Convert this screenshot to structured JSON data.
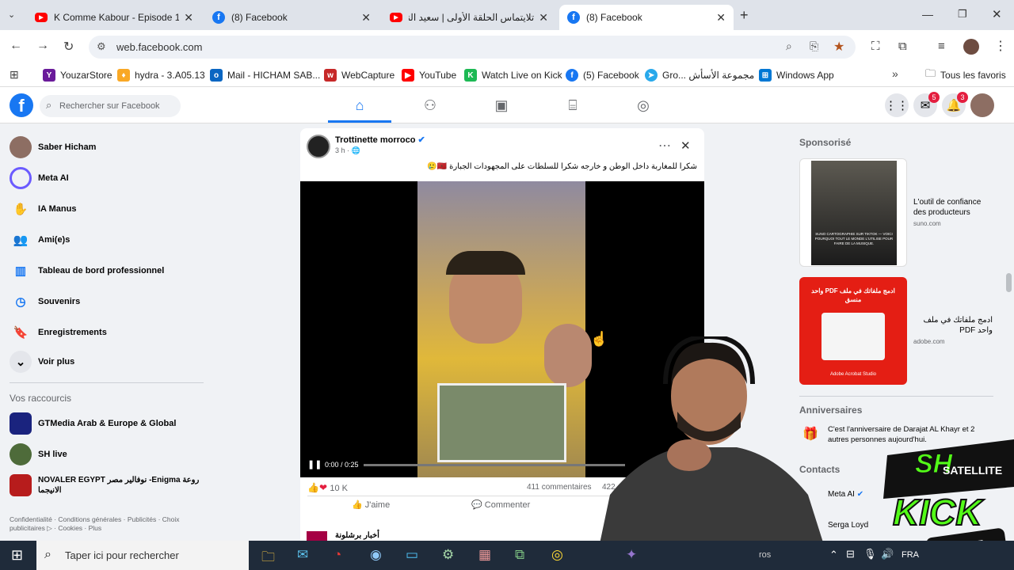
{
  "browser": {
    "tabs": [
      {
        "title": "K Comme Kabour - Episode 1 -",
        "icon": "youtube-icon"
      },
      {
        "title": "(8) Facebook",
        "icon": "facebook-icon"
      },
      {
        "title": "تلايتماس الحلقة الأولى | سعيد النا",
        "icon": "youtube-icon"
      },
      {
        "title": "(8) Facebook",
        "icon": "facebook-icon",
        "active": true
      }
    ],
    "url": "web.facebook.com",
    "bookmarks": [
      {
        "label": "YouzarStore",
        "color": "#6a1b9a",
        "glyph": "Y"
      },
      {
        "label": "hydra - 3.A05.13",
        "color": "#f9a825",
        "glyph": "♦"
      },
      {
        "label": "Mail - HICHAM SAB...",
        "color": "#0a66c2",
        "glyph": "o"
      },
      {
        "label": "WebCapture",
        "color": "#c62828",
        "glyph": "w"
      },
      {
        "label": "YouTube",
        "color": "#ff0000",
        "glyph": "▶"
      },
      {
        "label": "Watch Live on Kick",
        "color": "#1db954",
        "glyph": "K"
      },
      {
        "label": "(5) Facebook",
        "color": "#1877f2",
        "glyph": "f"
      },
      {
        "label": "Gro... مجموعة الأسأش",
        "color": "#29a9eb",
        "glyph": "➤"
      },
      {
        "label": "Windows App",
        "color": "#0078d4",
        "glyph": "⊞"
      }
    ],
    "all_bookmarks": "Tous les favoris"
  },
  "facebook": {
    "search_placeholder": "Rechercher sur Facebook",
    "messenger_badge": "5",
    "notif_badge": "3",
    "left_menu": [
      {
        "label": "Saber Hicham",
        "icon": "avatar"
      },
      {
        "label": "Meta AI",
        "icon": "meta-ai-icon"
      },
      {
        "label": "IA Manus",
        "icon": "manus-icon"
      },
      {
        "label": "Ami(e)s",
        "icon": "friends-icon"
      },
      {
        "label": "Tableau de bord professionnel",
        "icon": "dashboard-icon"
      },
      {
        "label": "Souvenirs",
        "icon": "memories-icon"
      },
      {
        "label": "Enregistrements",
        "icon": "saved-icon"
      },
      {
        "label": "Voir plus",
        "icon": "chevron-down-icon"
      }
    ],
    "shortcuts_title": "Vos raccourcis",
    "shortcuts": [
      {
        "label": "GTMedia Arab & Europe & Global"
      },
      {
        "label": "SH live"
      },
      {
        "label": "NOVALER EGYPT نوفالير مصر -Enigma روعة الانيجما"
      }
    ],
    "footer": "Confidentialité · Conditions générales · Publicités · Choix publicitaires ▷ · Cookies · Plus",
    "post": {
      "author": "Trottinette morroco",
      "time": "3 h",
      "text": "شكرا للمغاربة داخل الوطن و خارجه شكرا للسلطات على المجهودات الجبارة 🇲🇦🥲",
      "video_time": "0:00 / 0:25",
      "reactions": "10 K",
      "comments": "411 commentaires",
      "shares": "422",
      "like": "J'aime",
      "comment": "Commenter",
      "next_author": "أخبار برشلونة"
    },
    "sponsored_title": "Sponsorisé",
    "ads": [
      {
        "title": "L'outil de confiance des producteurs",
        "domain": "suno.com",
        "img_text": "SUNO CARTOGRAPHIE SUR TIKTOK — VOICI POURQUOI TOUT LE MONDE L'UTILISE POUR FAIRE DE LA MUSIQUE."
      },
      {
        "title": "ادمج ملفاتك في ملف واحد PDF",
        "domain": "adobe.com",
        "img_text": "ادمج ملفاتك في ملف PDF واحد منسق",
        "brand": "Adobe Acrobat Studio"
      }
    ],
    "birthdays_title": "Anniversaires",
    "birthday_text": "C'est l'anniversaire de Darajat AL Khayr et 2 autres personnes aujourd'hui.",
    "contacts_title": "Contacts",
    "contacts": [
      {
        "label": "Meta AI"
      },
      {
        "label": "Serga Loyd"
      }
    ]
  },
  "taskbar": {
    "search_placeholder": "Taper ici pour rechercher",
    "lang": "FRA",
    "tray_text": "ros"
  },
  "overlay": {
    "logo_line1": "SH",
    "logo_line2": "SATELLITE",
    "logo_line3": "KICK",
    "logo_line4": "LIVE"
  }
}
